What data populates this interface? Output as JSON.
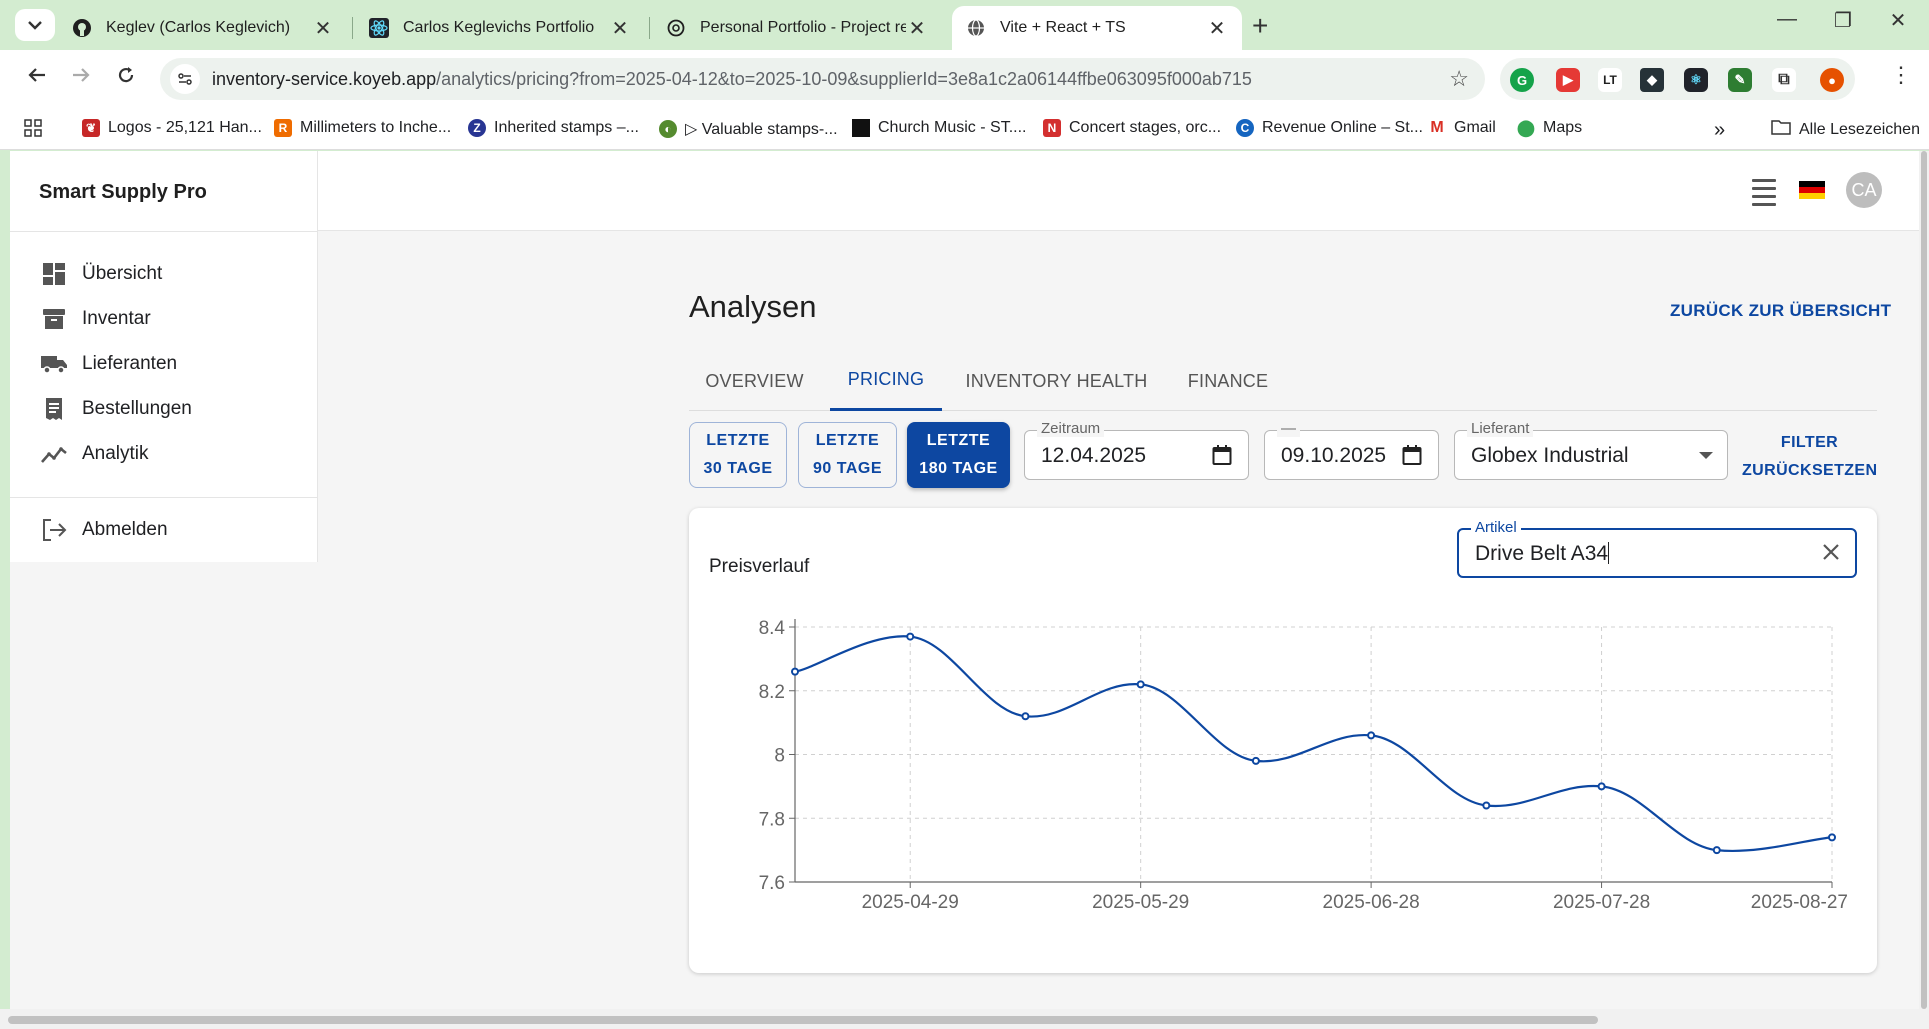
{
  "browser": {
    "tabs": [
      {
        "title": "Keglev (Carlos Keglevich)",
        "icon": "github-icon",
        "active": false
      },
      {
        "title": "Carlos Keglevichs Portfolio",
        "icon": "react-icon",
        "active": false
      },
      {
        "title": "Personal Portfolio - Project revie",
        "icon": "openai-icon",
        "active": false
      },
      {
        "title": "Vite + React + TS",
        "icon": "globe-icon",
        "active": true
      }
    ],
    "url_host": "inventory-service.koyeb.app",
    "url_path": "/analytics/pricing?from=2025-04-12&to=2025-10-09&supplierId=3e8a1c2a06144ffbe063095f000ab715",
    "bookmarks": [
      "Logos - 25,121 Han...",
      "Millimeters to Inche...",
      "Inherited stamps –...",
      "▷ Valuable stamps-...",
      "Church Music - ST....",
      "Concert stages, orc...",
      "Revenue Online – St...",
      "Gmail",
      "Maps"
    ],
    "all_bookmarks": "Alle Lesezeichen"
  },
  "app": {
    "brand": "Smart Supply Pro",
    "nav": [
      {
        "label": "Übersicht",
        "icon": "dashboard-icon"
      },
      {
        "label": "Inventar",
        "icon": "archive-icon"
      },
      {
        "label": "Lieferanten",
        "icon": "truck-icon"
      },
      {
        "label": "Bestellungen",
        "icon": "receipt-icon"
      },
      {
        "label": "Analytik",
        "icon": "analytics-icon"
      }
    ],
    "logout": "Abmelden",
    "avatar_initials": "CA",
    "page_title": "Analysen",
    "back_link": "ZURÜCK ZUR ÜBERSICHT",
    "tabs": [
      "OVERVIEW",
      "PRICING",
      "INVENTORY HEALTH",
      "FINANCE"
    ],
    "active_tab": "PRICING",
    "range_buttons": [
      {
        "line1": "LETZTE",
        "line2": "30 TAGE",
        "active": false
      },
      {
        "line1": "LETZTE",
        "line2": "90 TAGE",
        "active": false
      },
      {
        "line1": "LETZTE",
        "line2": "180 TAGE",
        "active": true
      }
    ],
    "filters": {
      "period_label": "Zeitraum",
      "from_date": "12.04.2025",
      "to_label": "—",
      "to_date": "09.10.2025",
      "supplier_label": "Lieferant",
      "supplier_value": "Globex Industrial",
      "reset_line1": "FILTER",
      "reset_line2": "ZURÜCKSETZEN"
    },
    "card": {
      "title": "Preisverlauf",
      "article_label": "Artikel",
      "article_value": "Drive Belt A34"
    }
  },
  "colors": {
    "accent": "#0d47a1",
    "chrome_bg": "#d3ecd0",
    "page_bg": "#f5f5f5"
  },
  "chart_data": {
    "type": "line",
    "x": [
      "2025-04-14",
      "2025-04-29",
      "2025-05-14",
      "2025-05-29",
      "2025-06-13",
      "2025-06-28",
      "2025-07-13",
      "2025-07-28",
      "2025-08-12",
      "2025-08-27"
    ],
    "series": [
      {
        "values": [
          8.26,
          8.37,
          8.12,
          8.22,
          7.98,
          8.06,
          7.84,
          7.9,
          7.7,
          7.74
        ]
      }
    ],
    "x_tick_labels": [
      "2025-04-29",
      "2025-05-29",
      "2025-06-28",
      "2025-07-28",
      "2025-08-27"
    ],
    "y_tick_labels": [
      "7.6",
      "7.8",
      "8",
      "8.2",
      "8.4"
    ],
    "y_ticks": [
      7.6,
      7.8,
      8.0,
      8.2,
      8.4
    ],
    "ylim": [
      7.6,
      8.4
    ],
    "grid": true,
    "line_color": "#0d47a1"
  }
}
